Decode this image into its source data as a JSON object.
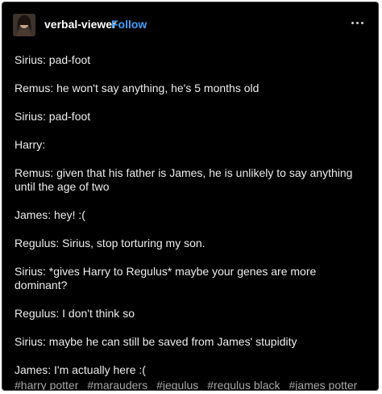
{
  "post": {
    "username": "verbal-viewer",
    "follow_label": "Follow",
    "avatar_icon": "user-avatar",
    "more_icon": "ellipsis-icon",
    "lines": [
      "Sirius: pad-foot",
      "Remus: he won't say anything, he's 5 months old",
      "Sirius: pad-foot",
      "Harry:",
      "Remus: given that his father is James, he is unlikely to say anything until the age of two",
      "James: hey! :(",
      "Regulus: Sirius, stop torturing my son.",
      "Sirius: *gives Harry to Regulus* maybe your genes are more dominant?",
      "Regulus: I don't think so",
      "Sirius: maybe he can still be saved from James' stupidity",
      "James: I'm actually here :("
    ],
    "tags": [
      "#harry potter",
      "#marauders",
      "#jegulus",
      "#regulus black",
      "#james potter"
    ]
  },
  "colors": {
    "background": "#000000",
    "text": "#ededed",
    "follow": "#3fa0ff",
    "tag": "#a8a8a8"
  }
}
